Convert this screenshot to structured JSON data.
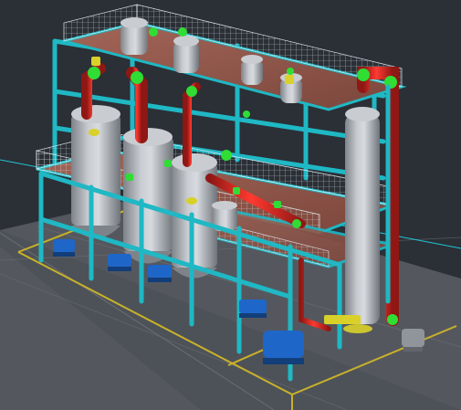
{
  "viewport": {
    "background": "#2b2f36",
    "ground_color": "#54585e",
    "ground_line_color": "#6a6c73",
    "marking_color": "#c9b12a",
    "axis_color": "#1ed7e6"
  },
  "colors": {
    "steel": "#1fb8c4",
    "steel_dark": "#168a93",
    "deck": "#9a5b4f",
    "deck_dark": "#7b463c",
    "railing": "#e8f3f8",
    "vessel": "#b7bcc2",
    "vessel_dark": "#7e8389",
    "pipe_red": "#d1261f",
    "pipe_red_dark": "#8f1714",
    "pipe_green": "#2fdd34",
    "pump_blue": "#1f66c9",
    "pump_blue_dark": "#123e7a",
    "yellow": "#d9d12a"
  },
  "icons": {
    "vessel": "vessel-icon",
    "pipe": "pipe-icon",
    "pump": "pump-icon",
    "valve": "valve-icon"
  }
}
